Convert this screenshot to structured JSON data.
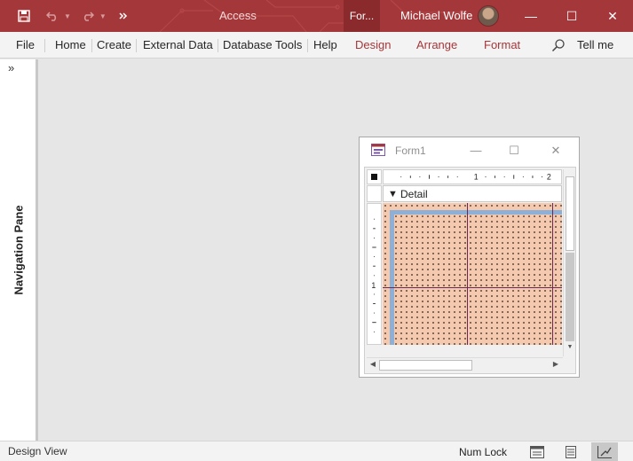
{
  "window": {
    "app_title": "Access",
    "context_tab": "For...",
    "user_name": "Michael Wolfe",
    "minimize": "—",
    "maximize": "☐",
    "close": "✕"
  },
  "quick_access": {
    "save_icon": "save-icon",
    "undo_icon": "undo-icon",
    "redo_icon": "redo-icon",
    "customize_icon": "customize-qat-icon"
  },
  "ribbon": {
    "tabs": [
      {
        "label": "File",
        "contextual": false
      },
      {
        "label": "Home",
        "contextual": false
      },
      {
        "label": "Create",
        "contextual": false
      },
      {
        "label": "External Data",
        "contextual": false
      },
      {
        "label": "Database Tools",
        "contextual": false
      },
      {
        "label": "Help",
        "contextual": false
      },
      {
        "label": "Design",
        "contextual": true
      },
      {
        "label": "Arrange",
        "contextual": true
      },
      {
        "label": "Format",
        "contextual": true
      }
    ],
    "tell_me": "Tell me"
  },
  "nav_pane": {
    "label": "Navigation Pane",
    "expand_glyph": "»"
  },
  "form_window": {
    "title": "Form1",
    "minimize": "—",
    "maximize": "☐",
    "close": "✕",
    "section_label": "Detail",
    "ruler_labels": {
      "h1": "1",
      "h2": "2",
      "v1": "1"
    }
  },
  "status_bar": {
    "mode": "Design View",
    "num_lock": "Num Lock"
  },
  "colors": {
    "title_bar": "#a4373a",
    "context_tab_text": "#a4373a",
    "grid_bg": "#f4c9ae",
    "grid_lines": "#6b2a55"
  }
}
